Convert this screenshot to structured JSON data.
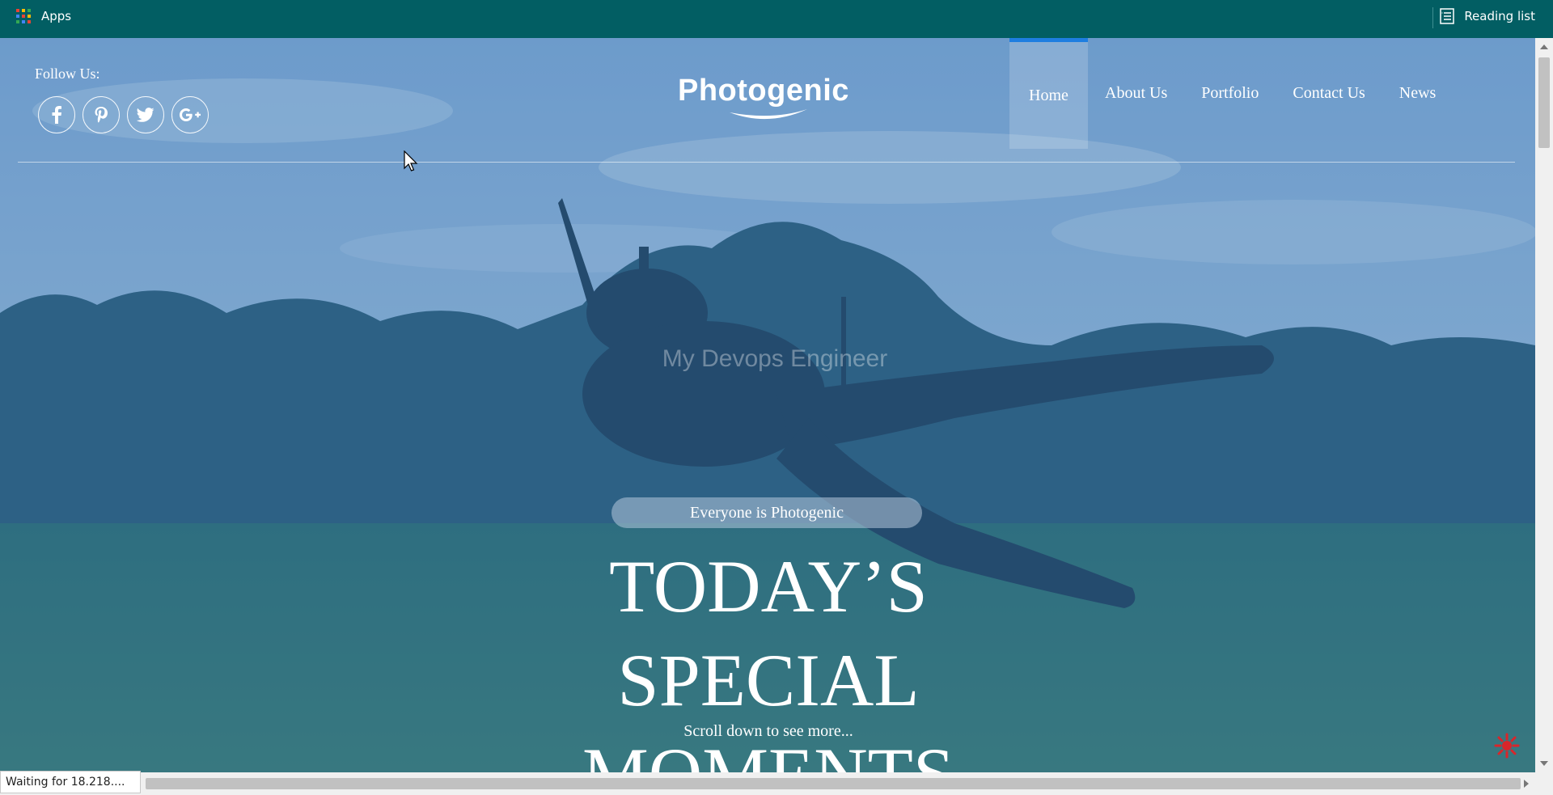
{
  "bookmarks_bar": {
    "apps_label": "Apps",
    "reading_list_label": "Reading list"
  },
  "header": {
    "follow_label": "Follow Us:",
    "socials": [
      "facebook-icon",
      "pinterest-icon",
      "twitter-icon",
      "google-plus-icon"
    ],
    "logo": "Photogenic",
    "nav": [
      {
        "label": "Home",
        "active": true
      },
      {
        "label": "About Us",
        "active": false
      },
      {
        "label": "Portfolio",
        "active": false
      },
      {
        "label": "Contact Us",
        "active": false
      },
      {
        "label": "News",
        "active": false
      }
    ]
  },
  "hero": {
    "ghost_text": "My Devops Engineer",
    "tagline": "Everyone is Photogenic",
    "title_lines": [
      "TODAY’S",
      "SPECIAL",
      "MOMENTS"
    ],
    "scroll_hint": "Scroll down to see more..."
  },
  "status_bar": {
    "text": "Waiting for 18.218...."
  },
  "colors": {
    "bookmarks_bg": "#025e63",
    "nav_active_accent": "#1e7ee0",
    "overlay": "#2e6ca8"
  }
}
